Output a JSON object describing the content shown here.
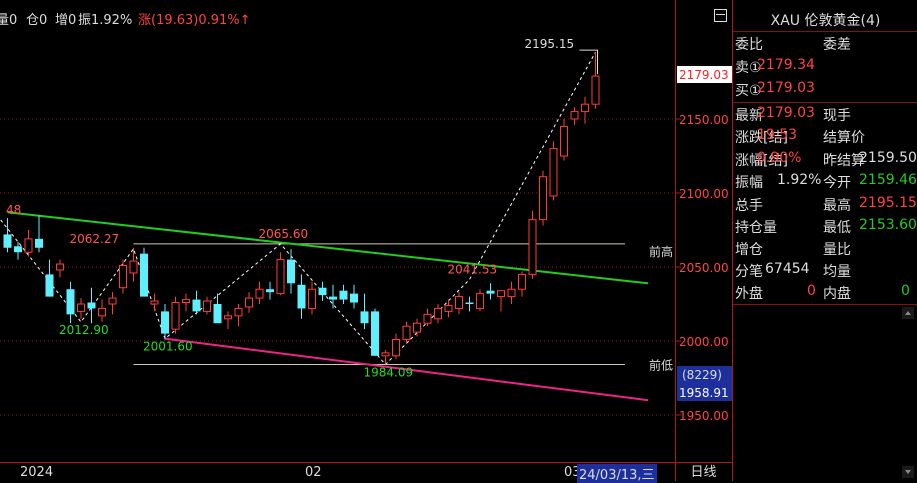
{
  "header": {
    "vol": "量0",
    "pos": "仓0",
    "incr": "增0",
    "amp": "振1.92%",
    "change": "涨(19.63)0.91%↑"
  },
  "chart_data": {
    "type": "candlestick",
    "ylim": [
      1925,
      2225
    ],
    "yticks": [
      1950,
      2000,
      2050,
      2100,
      2150
    ],
    "ytick_labels": [
      "1950.00",
      "2000.00",
      "2050.00",
      "2100.00",
      "2150.00"
    ],
    "current_price": "2179.03",
    "cursor_price": "1958.91",
    "cursor_count": "(8229)",
    "xtick_labels": [
      {
        "i": 1,
        "label": "2024"
      },
      {
        "i": 26,
        "label": "02"
      },
      {
        "i": 47,
        "label": "03"
      }
    ],
    "cursor_date": "24/03/13,三",
    "period_label": "日线",
    "candles": [
      [
        2072,
        2083,
        2060,
        2063
      ],
      [
        2064,
        2067,
        2055,
        2060
      ],
      [
        2060,
        2075,
        2057,
        2069
      ],
      [
        2069,
        2085,
        2060,
        2063
      ],
      [
        2045,
        2055,
        2030,
        2030
      ],
      [
        2048,
        2055,
        2043,
        2052
      ],
      [
        2035,
        2040,
        2012,
        2018
      ],
      [
        2020,
        2029,
        2015,
        2025
      ],
      [
        2026,
        2036,
        2012,
        2022
      ],
      [
        2017,
        2028,
        2013,
        2022
      ],
      [
        2025,
        2033,
        2018,
        2029
      ],
      [
        2036,
        2055,
        2032,
        2051
      ],
      [
        2046,
        2063,
        2040,
        2054
      ],
      [
        2059,
        2063,
        2035,
        2030
      ],
      [
        2025,
        2032,
        2020,
        2027
      ],
      [
        2020,
        2025,
        2001,
        2005
      ],
      [
        2008,
        2030,
        2005,
        2026
      ],
      [
        2026,
        2032,
        2020,
        2028
      ],
      [
        2028,
        2034,
        2018,
        2020
      ],
      [
        2020,
        2030,
        2018,
        2027
      ],
      [
        2025,
        2032,
        2015,
        2012
      ],
      [
        2015,
        2020,
        2008,
        2017
      ],
      [
        2017,
        2025,
        2010,
        2022
      ],
      [
        2023,
        2033,
        2019,
        2029
      ],
      [
        2029,
        2040,
        2025,
        2035
      ],
      [
        2035,
        2040,
        2028,
        2033
      ],
      [
        2032,
        2060,
        2031,
        2055
      ],
      [
        2055,
        2062,
        2032,
        2039
      ],
      [
        2038,
        2045,
        2015,
        2022
      ],
      [
        2022,
        2040,
        2018,
        2035
      ],
      [
        2036,
        2040,
        2027,
        2031
      ],
      [
        2030,
        2038,
        2022,
        2028
      ],
      [
        2034,
        2038,
        2025,
        2028
      ],
      [
        2032,
        2038,
        2022,
        2026
      ],
      [
        2020,
        2032,
        2008,
        2012
      ],
      [
        2020,
        2022,
        1990,
        1990
      ],
      [
        1990,
        1994,
        1984,
        1992
      ],
      [
        1990,
        2005,
        1988,
        2001
      ],
      [
        2001,
        2013,
        1998,
        2010
      ],
      [
        2006,
        2015,
        2003,
        2012
      ],
      [
        2012,
        2022,
        2010,
        2018
      ],
      [
        2015,
        2025,
        2012,
        2022
      ],
      [
        2020,
        2028,
        2016,
        2024
      ],
      [
        2022,
        2033,
        2018,
        2030
      ],
      [
        2026,
        2030,
        2020,
        2025
      ],
      [
        2022,
        2035,
        2020,
        2032
      ],
      [
        2034,
        2039,
        2028,
        2032
      ],
      [
        2030,
        2032,
        2020,
        2034
      ],
      [
        2030,
        2040,
        2025,
        2035
      ],
      [
        2035,
        2047,
        2030,
        2045
      ],
      [
        2045,
        2088,
        2042,
        2082
      ],
      [
        2082,
        2115,
        2078,
        2111
      ],
      [
        2098,
        2135,
        2095,
        2130
      ],
      [
        2125,
        2150,
        2122,
        2145
      ],
      [
        2150,
        2158,
        2146,
        2155
      ],
      [
        2155,
        2165,
        2147,
        2160
      ],
      [
        2160,
        2195,
        2157,
        2179
      ]
    ],
    "annotations": [
      {
        "label": "2062.27",
        "price": 2062.27,
        "i": 8,
        "color": "#ff5555"
      },
      {
        "label": "2065.60",
        "price": 2065.6,
        "i": 26,
        "color": "#ff5555"
      },
      {
        "label": "2041.53",
        "price": 2041.53,
        "i": 44,
        "color": "#ff5555"
      },
      {
        "label": "2195.15",
        "price": 2195.15,
        "i": 56,
        "color": "#dddddd"
      },
      {
        "label": "2012.90",
        "price": 2012.9,
        "i": 7,
        "color": "#22dd22"
      },
      {
        "label": "2001.60",
        "price": 2001.6,
        "i": 15,
        "color": "#22dd22"
      },
      {
        "label": "1984.09",
        "price": 1984.09,
        "i": 36,
        "color": "#22dd22"
      },
      {
        "label": "48",
        "price": 2087,
        "i": 0,
        "color": "#ff5555"
      }
    ],
    "zigzag": [
      [
        2085,
        -1
      ],
      [
        2012.9,
        7
      ],
      [
        2062.27,
        12
      ],
      [
        2001.6,
        15
      ],
      [
        2065.6,
        26
      ],
      [
        1984.09,
        36
      ],
      [
        2041.53,
        44
      ],
      [
        2195.15,
        56
      ]
    ],
    "trendlines": [
      {
        "name": "green",
        "color": "#22cc22",
        "from": [
          2087,
          0
        ],
        "to": [
          2039,
          61
        ]
      },
      {
        "name": "magenta",
        "color": "#ee2288",
        "from": [
          2001.6,
          15
        ],
        "to": [
          1960,
          61
        ]
      }
    ],
    "levels": [
      {
        "price": 2065.6,
        "label": "前高"
      },
      {
        "price": 1984.09,
        "label": "前低"
      }
    ]
  },
  "side": {
    "title": "XAU 伦敦黄金(4)",
    "rows": [
      {
        "label": "委比",
        "value": "",
        "label2": "委差",
        "value2": ""
      },
      {
        "label": "卖①",
        "value": "2179.34"
      },
      {
        "label": "买①",
        "value": "2179.03"
      },
      {
        "label": "最新",
        "value": "2179.03",
        "label2": "现手",
        "value2": ""
      },
      {
        "label": "涨跌[结]",
        "value": "19.53",
        "label2": "结算价",
        "value2": ""
      },
      {
        "label": "涨幅[结]",
        "value": "0.90%",
        "label2": "昨结算",
        "value2": "2159.50"
      },
      {
        "label": "振幅",
        "value": "1.92%",
        "label2": "今开",
        "value2": "2159.46"
      },
      {
        "label": "总手",
        "value": "",
        "label2": "最高",
        "value2": "2195.15"
      },
      {
        "label": "持仓量",
        "value": "",
        "label2": "最低",
        "value2": "2153.60"
      },
      {
        "label": "增仓",
        "value": "",
        "label2": "量比",
        "value2": ""
      },
      {
        "label": "分笔",
        "value": "67454",
        "label2": "均量",
        "value2": ""
      },
      {
        "label": "外盘",
        "value": "0",
        "label2": "内盘",
        "value2": "0"
      }
    ]
  }
}
